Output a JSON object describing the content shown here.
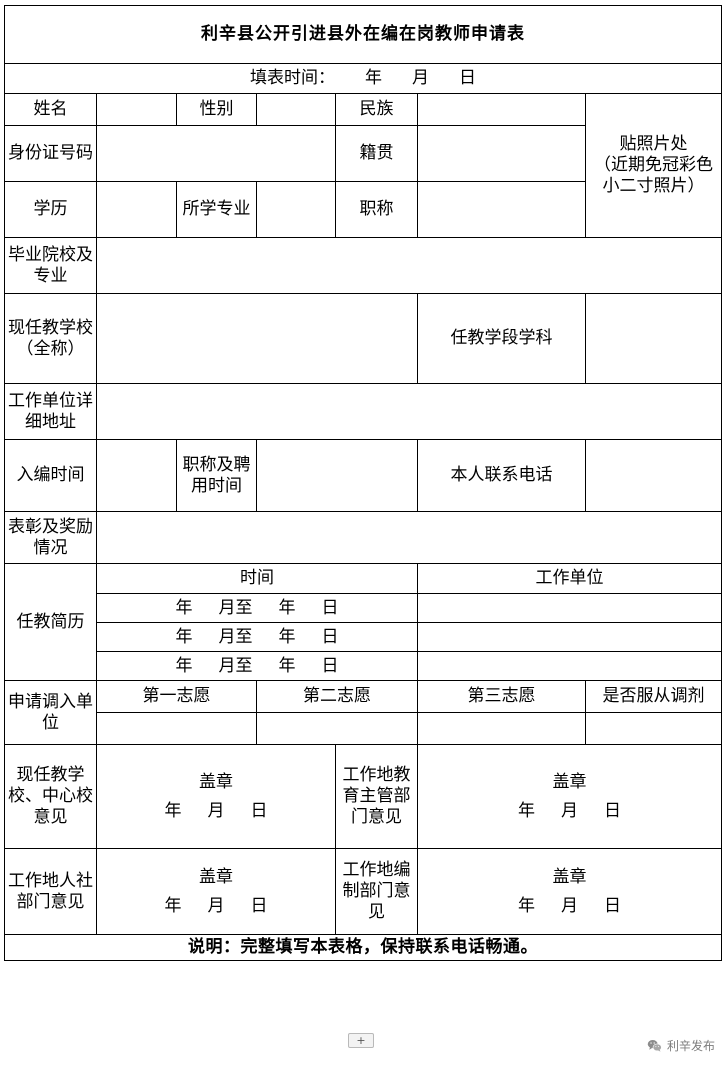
{
  "document": {
    "title": "利辛县公开引进县外在编在岗教师申请表",
    "date_bar": {
      "label": "填表时间：",
      "year": "年",
      "month": "月",
      "day": "日"
    },
    "labels": {
      "name": "姓名",
      "gender": "性别",
      "ethnicity": "民族",
      "id_number": "身份证号码",
      "native_place": "籍贯",
      "education": "学历",
      "major": "所学专业",
      "title_rank": "职称",
      "graduate_school": "毕业院校及专业",
      "current_school": "现任教学校（全称）",
      "teaching_stage_subject": "任教学段学科",
      "work_unit_address": "工作单位详细地址",
      "entry_time": "入编时间",
      "title_and_hire_time": "职称及聘用时间",
      "personal_phone": "本人联系电话",
      "awards": "表彰及奖励情况",
      "resume": "任教简历",
      "resume_time": "时间",
      "resume_work_unit": "工作单位",
      "apply_unit": "申请调入单位",
      "choice_1": "第一志愿",
      "choice_2": "第二志愿",
      "choice_3": "第三志愿",
      "obey_adjust": "是否服从调剂",
      "opinion_school": "现任教学校、中心校意见",
      "opinion_edu_dept": "工作地教育主管部门意见",
      "opinion_hr": "工作地人社部门意见",
      "opinion_staffing": "工作地编制部门意见"
    },
    "photo_box": {
      "line1": "贴照片处",
      "line2": "（近期免冠彩色",
      "line3": "小二寸照片）"
    },
    "resume_rows": [
      {
        "year": "年",
        "month": "月至",
        "year2": "年",
        "day": "日",
        "unit": ""
      },
      {
        "year": "年",
        "month": "月至",
        "year2": "年",
        "day": "日",
        "unit": ""
      },
      {
        "year": "年",
        "month": "月至",
        "year2": "年",
        "day": "日",
        "unit": ""
      }
    ],
    "seal": {
      "text": "盖章",
      "year": "年",
      "month": "月",
      "day": "日"
    },
    "note": "说明：完整填写本表格，保持联系电话畅通。"
  },
  "footer": {
    "plus_button": "+",
    "wechat_account": "利辛发布"
  }
}
